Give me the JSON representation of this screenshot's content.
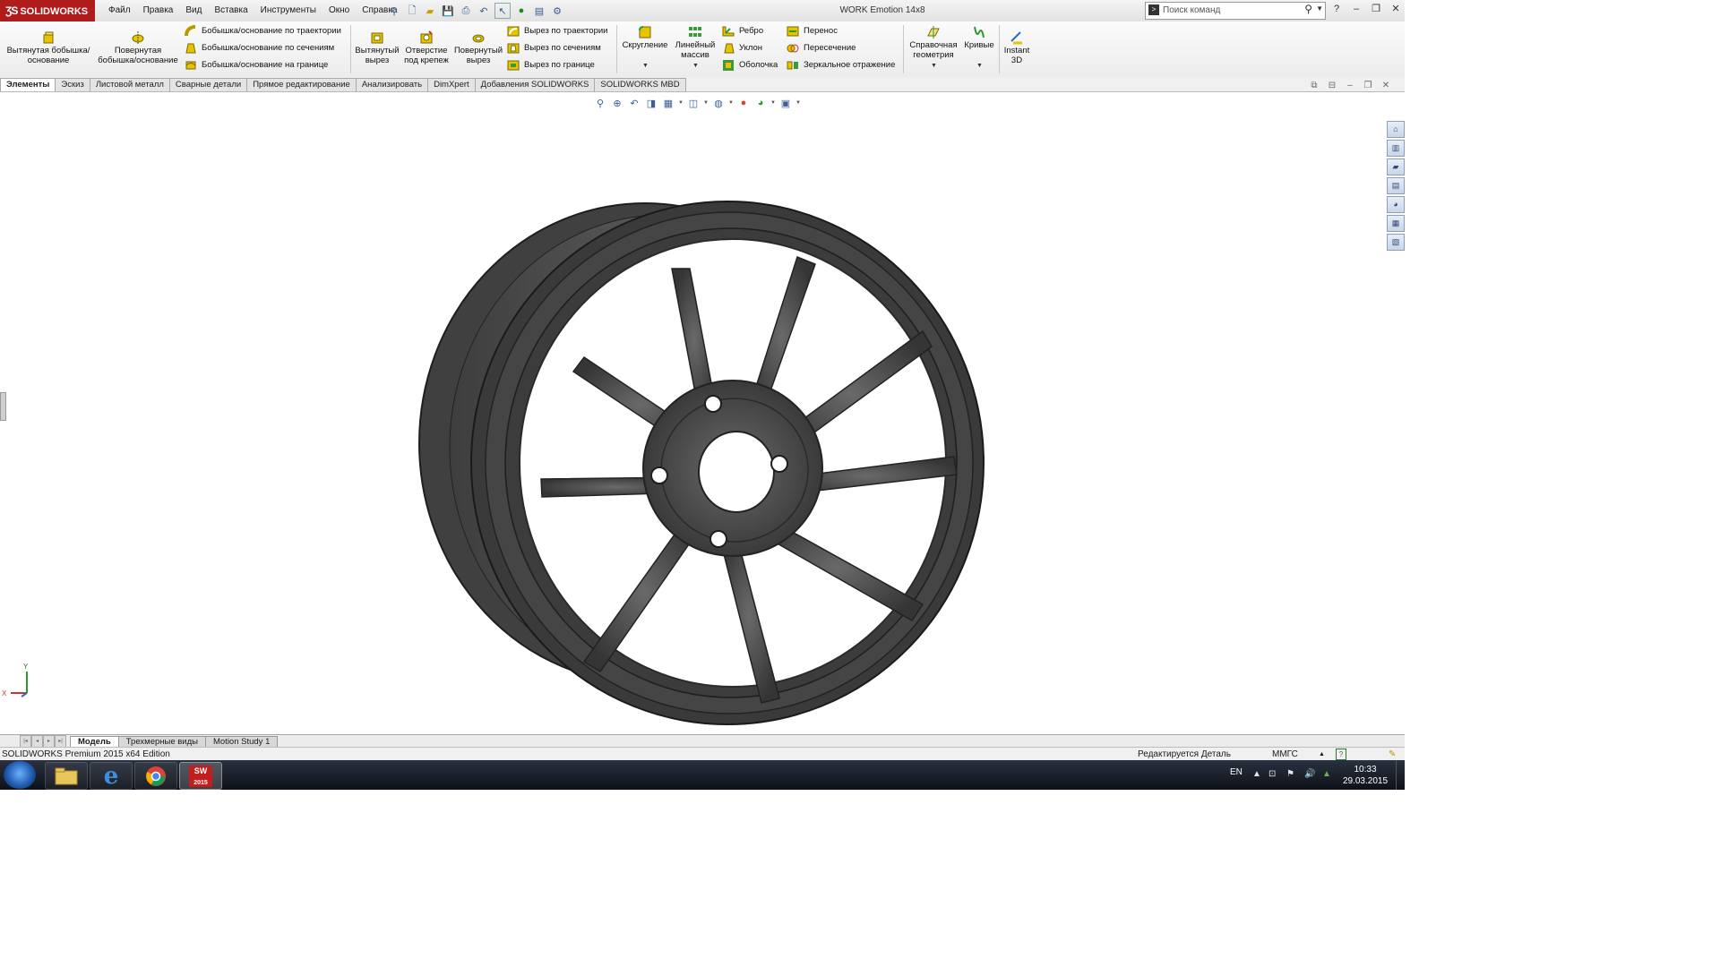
{
  "app": {
    "logo": "SOLIDWORKS",
    "menu": [
      "Файл",
      "Правка",
      "Вид",
      "Вставка",
      "Инструменты",
      "Окно",
      "Справка"
    ],
    "document_title": "WORK Emotion 14x8",
    "search_placeholder": "Поиск команд"
  },
  "command_manager": {
    "extrude_boss": "Вытянутая бобышка/основание",
    "revolve_boss": "Повернутая бобышка/основание",
    "sweep_boss": "Бобышка/основание по траектории",
    "loft_boss": "Бобышка/основание по сечениям",
    "boundary_boss": "Бобышка/основание на границе",
    "extrude_cut": "Вытянутый вырез",
    "hole_wizard": "Отверстие под крепеж",
    "revolve_cut": "Повернутый вырез",
    "sweep_cut": "Вырез по траектории",
    "loft_cut": "Вырез по сечениям",
    "boundary_cut": "Вырез по границе",
    "fillet": "Скругление",
    "linear_pattern": "Линейный массив",
    "rib": "Ребро",
    "draft": "Уклон",
    "shell": "Оболочка",
    "wrap": "Перенос",
    "intersect": "Пересечение",
    "mirror": "Зеркальное отражение",
    "ref_geometry": "Справочная геометрия",
    "curves": "Кривые",
    "instant3d": "Instant 3D"
  },
  "tabs": [
    "Элементы",
    "Эскиз",
    "Листовой металл",
    "Сварные детали",
    "Прямое редактирование",
    "Анализировать",
    "DimXpert",
    "Добавления SOLIDWORKS",
    "SOLIDWORKS MBD"
  ],
  "bottom_tabs": [
    "Модель",
    "Трехмерные виды",
    "Motion Study 1"
  ],
  "status": {
    "edition": "SOLIDWORKS Premium 2015 x64 Edition",
    "editing": "Редактируется Деталь",
    "units": "ММГС"
  },
  "triad": {
    "x": "X",
    "y": "Y"
  },
  "taskbar": {
    "sw_badge": "2015",
    "lang": "EN",
    "time": "10:33",
    "date": "29.03.2015"
  },
  "colors": {
    "brand": "#b01b1b",
    "wheel_body": "#4a4a4a",
    "wheel_dark": "#2e2e2e"
  }
}
